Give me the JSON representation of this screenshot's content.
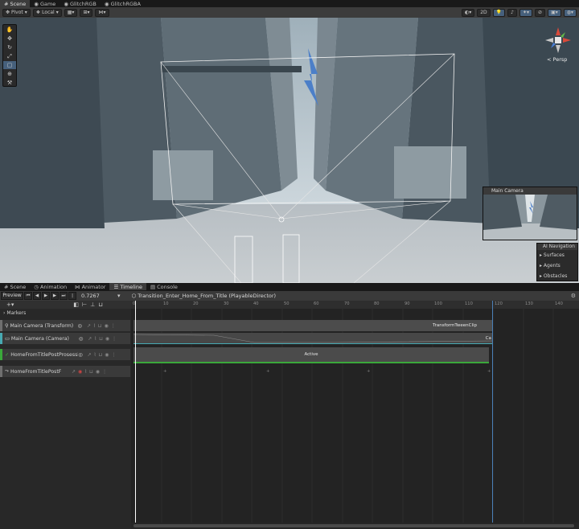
{
  "top_tabs": [
    {
      "label": "Scene",
      "icon": "hashtag-icon"
    },
    {
      "label": "Game",
      "icon": "gamepad-icon"
    },
    {
      "label": "GlitchRGB",
      "icon": "eye-icon"
    },
    {
      "label": "GlitchRGBA",
      "icon": "eye-icon"
    }
  ],
  "scene_toolbar": {
    "pivot": "Pivot",
    "local": "Local",
    "mode_2d": "2D"
  },
  "gizmo": {
    "projection": "< Persp"
  },
  "camera_preview": {
    "title": "Main Camera"
  },
  "ai_nav": {
    "title": "AI Navigation",
    "items": [
      "Surfaces",
      "Agents",
      "Obstacles"
    ]
  },
  "bottom_tabs": [
    {
      "label": "Scene",
      "icon": "hashtag-icon"
    },
    {
      "label": "Animation",
      "icon": "clock-icon"
    },
    {
      "label": "Animator",
      "icon": "animator-icon"
    },
    {
      "label": "Timeline",
      "icon": "timeline-icon"
    },
    {
      "label": "Console",
      "icon": "console-icon"
    }
  ],
  "timeline": {
    "preview": "Preview",
    "time": "0.7267",
    "director": "Transition_Enter_Home_From_Title (PlayableDirector)",
    "markers_label": "Markers",
    "ruler_ticks": [
      "0",
      "10",
      "20",
      "30",
      "40",
      "50",
      "60",
      "70",
      "80",
      "90",
      "100",
      "110",
      "120",
      "130",
      "140"
    ],
    "tracks": [
      {
        "name": "Main Camera (Transform)",
        "color": "#6f6f6f"
      },
      {
        "name": "Main Camera (Camera)",
        "color": "#47a9b2"
      },
      {
        "name": "HomeFromTitlePostProsessi",
        "color": "#3aa83a"
      },
      {
        "name": "HomeFromTitlePostF",
        "color": "#6f6f6f"
      }
    ],
    "clips": {
      "transform": "TransformTweenClip",
      "camera": "Ca",
      "activation": "Active"
    }
  },
  "colors": {
    "accent": "#46607c",
    "playhead": "#ffffff",
    "end_marker": "#4a7fb6",
    "activation": "#3aa83a"
  }
}
